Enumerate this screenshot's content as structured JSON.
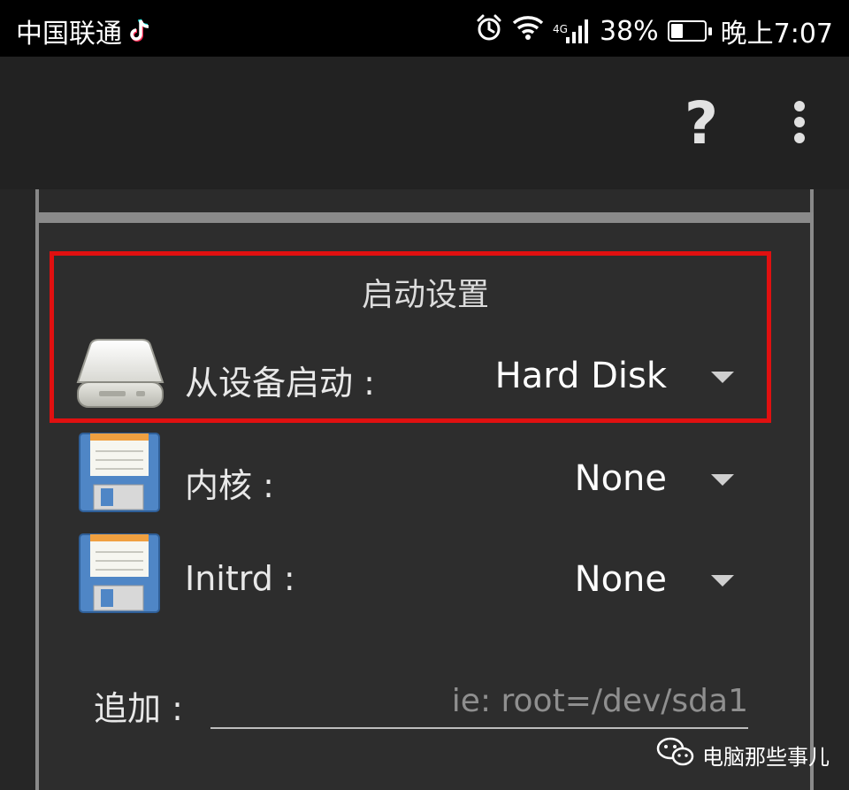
{
  "status_bar": {
    "carrier": "中国联通",
    "network_label": "4G",
    "battery_percent": "38%",
    "battery_level": 0.38,
    "time": "晚上7:07",
    "icons": [
      "tiktok-icon",
      "alarm-icon",
      "wifi-icon",
      "signal-icon",
      "battery-icon"
    ]
  },
  "toolbar": {
    "help_label": "?",
    "icons": [
      "help-icon",
      "overflow-menu-icon"
    ]
  },
  "boot_settings": {
    "title": "启动设置",
    "rows": [
      {
        "label": "从设备启动 :",
        "value": "Hard Disk",
        "icon": "hard-disk-icon"
      },
      {
        "label": "内核 :",
        "value": "None",
        "icon": "floppy-disk-icon"
      },
      {
        "label": "Initrd :",
        "value": "None",
        "icon": "floppy-disk-icon"
      }
    ],
    "append": {
      "label": "追加 :",
      "value": "",
      "placeholder": "ie: root=/dev/sda1"
    }
  },
  "watermark": {
    "text": "电脑那些事儿",
    "icon": "wechat-icon"
  },
  "colors": {
    "highlight": "#e01010",
    "background": "#2b2b2b",
    "toolbar": "#222222",
    "statusbar": "#000000"
  }
}
